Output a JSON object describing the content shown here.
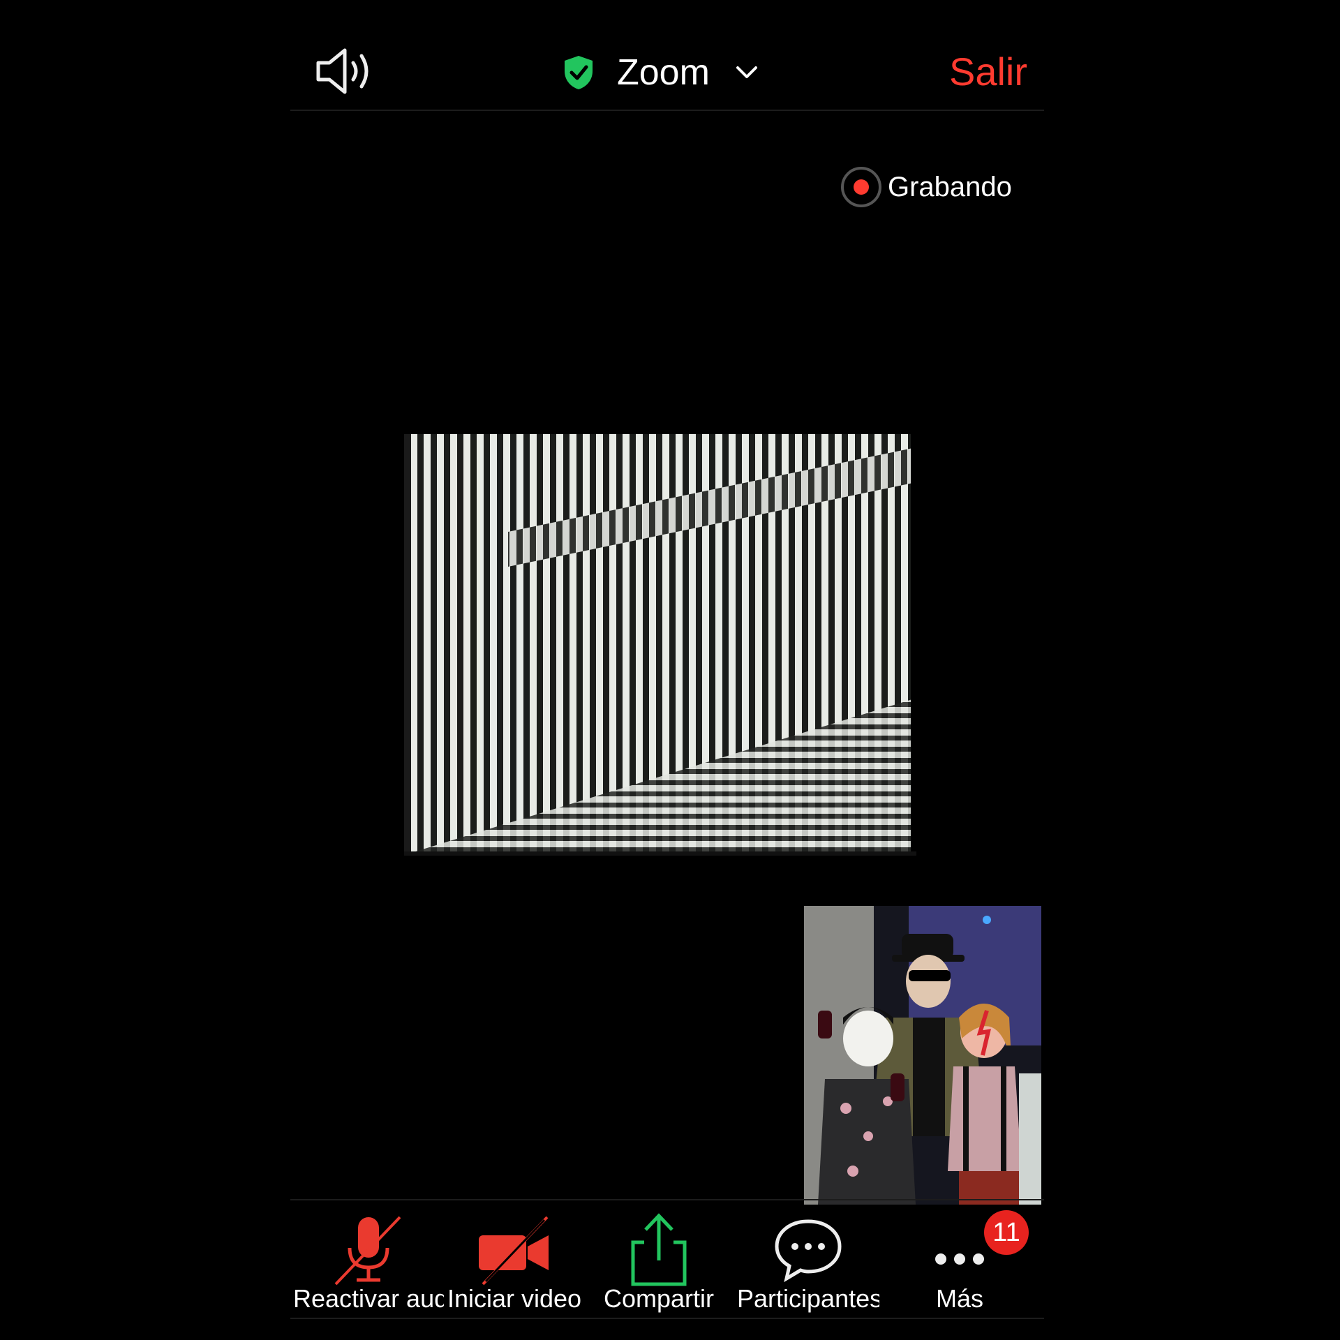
{
  "header": {
    "title": "Zoom",
    "leave_label": "Salir"
  },
  "recording": {
    "label": "Grabando"
  },
  "toolbar": {
    "items": [
      {
        "label": "Reactivar audio",
        "icon": "mic-muted-icon"
      },
      {
        "label": "Iniciar video",
        "icon": "video-off-icon"
      },
      {
        "label": "Compartir",
        "icon": "share-icon"
      },
      {
        "label": "Participantes",
        "icon": "chat-bubble-icon"
      },
      {
        "label": "Más",
        "icon": "more-icon",
        "badge": "11"
      }
    ]
  },
  "colors": {
    "accent_red": "#ff3b30",
    "share_green": "#22c55e",
    "shield_green": "#22c55e",
    "badge_red": "#e8231f"
  }
}
